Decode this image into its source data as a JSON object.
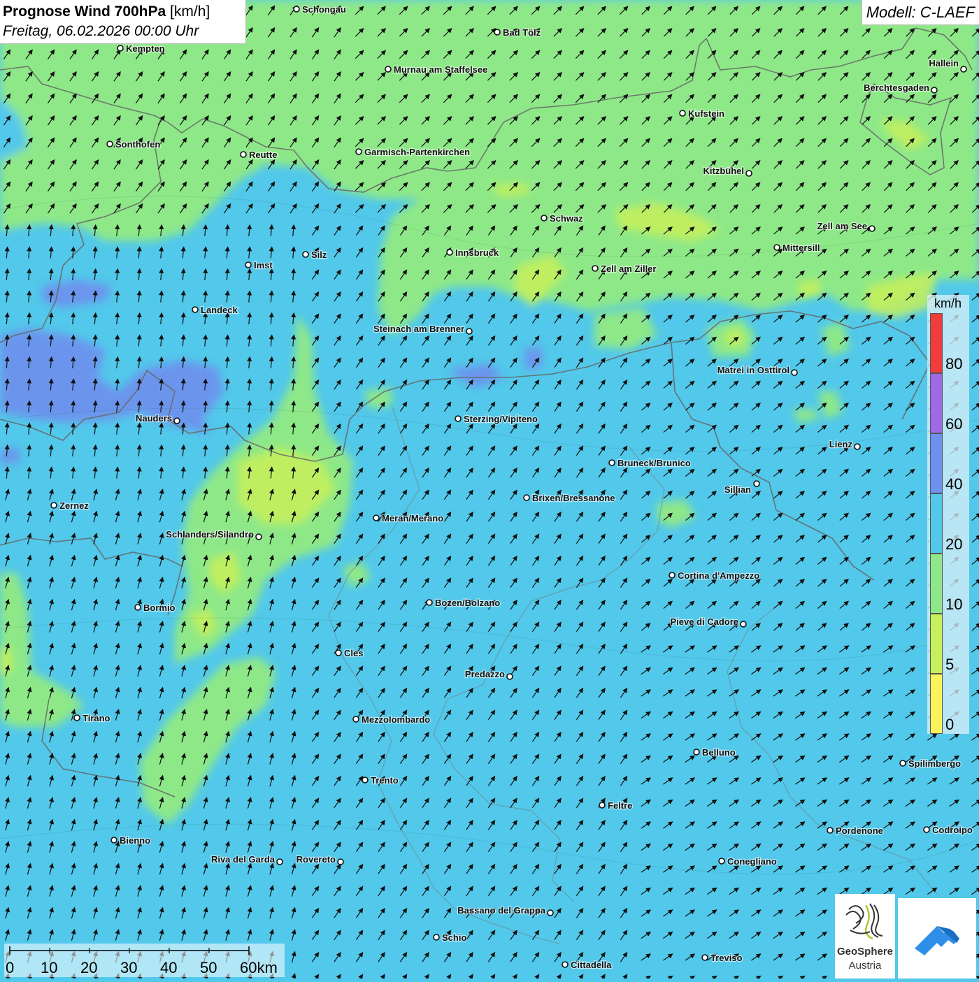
{
  "header": {
    "title_bold": "Prognose Wind 700hPa",
    "title_unit": "[km/h]",
    "date": "Freitag, 06.02.2026 00:00 Uhr",
    "model": "Modell: C-LAEF"
  },
  "legend": {
    "unit": "km/h",
    "levels": [
      "0",
      "5",
      "10",
      "20",
      "40",
      "60",
      "80"
    ],
    "colors": [
      "#f8f45a",
      "#c8f05a",
      "#8ee888",
      "#52c8ea",
      "#6e90ee",
      "#9e6ae6",
      "#f03c3c"
    ]
  },
  "scalebar": {
    "labels": [
      "0",
      "10",
      "20",
      "30",
      "40",
      "50",
      "60km"
    ]
  },
  "logos": {
    "geosphere_line1": "GeoSphere",
    "geosphere_line2": "Austria"
  },
  "cities": [
    {
      "name": "Schongau"
    },
    {
      "name": "Bad Tölz"
    },
    {
      "name": "Kempten"
    },
    {
      "name": "Murnau am Staffelsee"
    },
    {
      "name": "Hallein"
    },
    {
      "name": "Berchtesgaden"
    },
    {
      "name": "Kufstein"
    },
    {
      "name": "Sonthofen"
    },
    {
      "name": "Reutte"
    },
    {
      "name": "Garmisch-Partenkirchen"
    },
    {
      "name": "Kitzbühel"
    },
    {
      "name": "Schwaz"
    },
    {
      "name": "Zell am See"
    },
    {
      "name": "Mittersill"
    },
    {
      "name": "Innsbruck"
    },
    {
      "name": "Zell am Ziller"
    },
    {
      "name": "Imst"
    },
    {
      "name": "Silz"
    },
    {
      "name": "Landeck"
    },
    {
      "name": "Steinach am Brenner"
    },
    {
      "name": "Matrei in Osttirol"
    },
    {
      "name": "Nauders"
    },
    {
      "name": "Sterzing/Vipiteno"
    },
    {
      "name": "Lienz"
    },
    {
      "name": "Bruneck/Brunico"
    },
    {
      "name": "Sillian"
    },
    {
      "name": "Zernez"
    },
    {
      "name": "Brixen/Bressanone"
    },
    {
      "name": "Meran/Merano"
    },
    {
      "name": "Schlanders/Silandro"
    },
    {
      "name": "Cortina d'Ampezzo"
    },
    {
      "name": "Bozen/Bolzano"
    },
    {
      "name": "Bormio"
    },
    {
      "name": "Pieve di Cadore"
    },
    {
      "name": "Cles"
    },
    {
      "name": "Predazzo"
    },
    {
      "name": "Tirano"
    },
    {
      "name": "Mezzolombardo"
    },
    {
      "name": "Belluno"
    },
    {
      "name": "Spilimbergo"
    },
    {
      "name": "Trento"
    },
    {
      "name": "Feltre"
    },
    {
      "name": "Bienno"
    },
    {
      "name": "Pordenone"
    },
    {
      "name": "Codroipo"
    },
    {
      "name": "Riva del Garda"
    },
    {
      "name": "Rovereto"
    },
    {
      "name": "Conegliano"
    },
    {
      "name": "Bassano del Grappa"
    },
    {
      "name": "Schio"
    },
    {
      "name": "Treviso"
    },
    {
      "name": "Cittadella"
    }
  ]
}
